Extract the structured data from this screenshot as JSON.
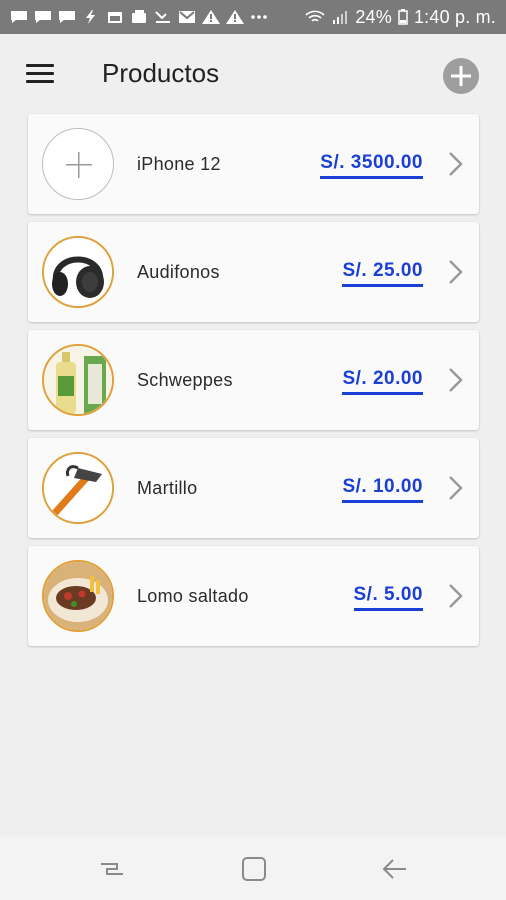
{
  "status_bar": {
    "battery": "24%",
    "time": "1:40 p. m.",
    "left_icons": [
      "message-icon",
      "message-icon",
      "message-icon",
      "flash-icon",
      "calendar-icon",
      "wallet-icon",
      "missed-call-icon",
      "gmail-icon",
      "warning-icon",
      "warning-icon",
      "more-icon"
    ],
    "right_icons": [
      "wifi-icon",
      "signal-icon",
      "battery-icon"
    ]
  },
  "header": {
    "title": "Productos",
    "menu_icon": "hamburger-icon",
    "add_icon": "add-circle-icon"
  },
  "products": [
    {
      "name": "iPhone 12",
      "price": "S/. 3500.00",
      "image": "placeholder-plus"
    },
    {
      "name": "Audifonos",
      "price": "S/. 25.00",
      "image": "headphones-photo"
    },
    {
      "name": "Schweppes",
      "price": "S/. 20.00",
      "image": "bottle-photo"
    },
    {
      "name": "Martillo",
      "price": "S/. 10.00",
      "image": "hammer-photo"
    },
    {
      "name": "Lomo saltado",
      "price": "S/. 5.00",
      "image": "dish-photo"
    }
  ],
  "colors": {
    "price": "#1a3fd6",
    "status_bar": "#7a7a7a",
    "background": "#efefef",
    "photo_border": "#e0a03a"
  },
  "nav_bar": [
    "recents-icon",
    "home-icon",
    "back-icon"
  ]
}
